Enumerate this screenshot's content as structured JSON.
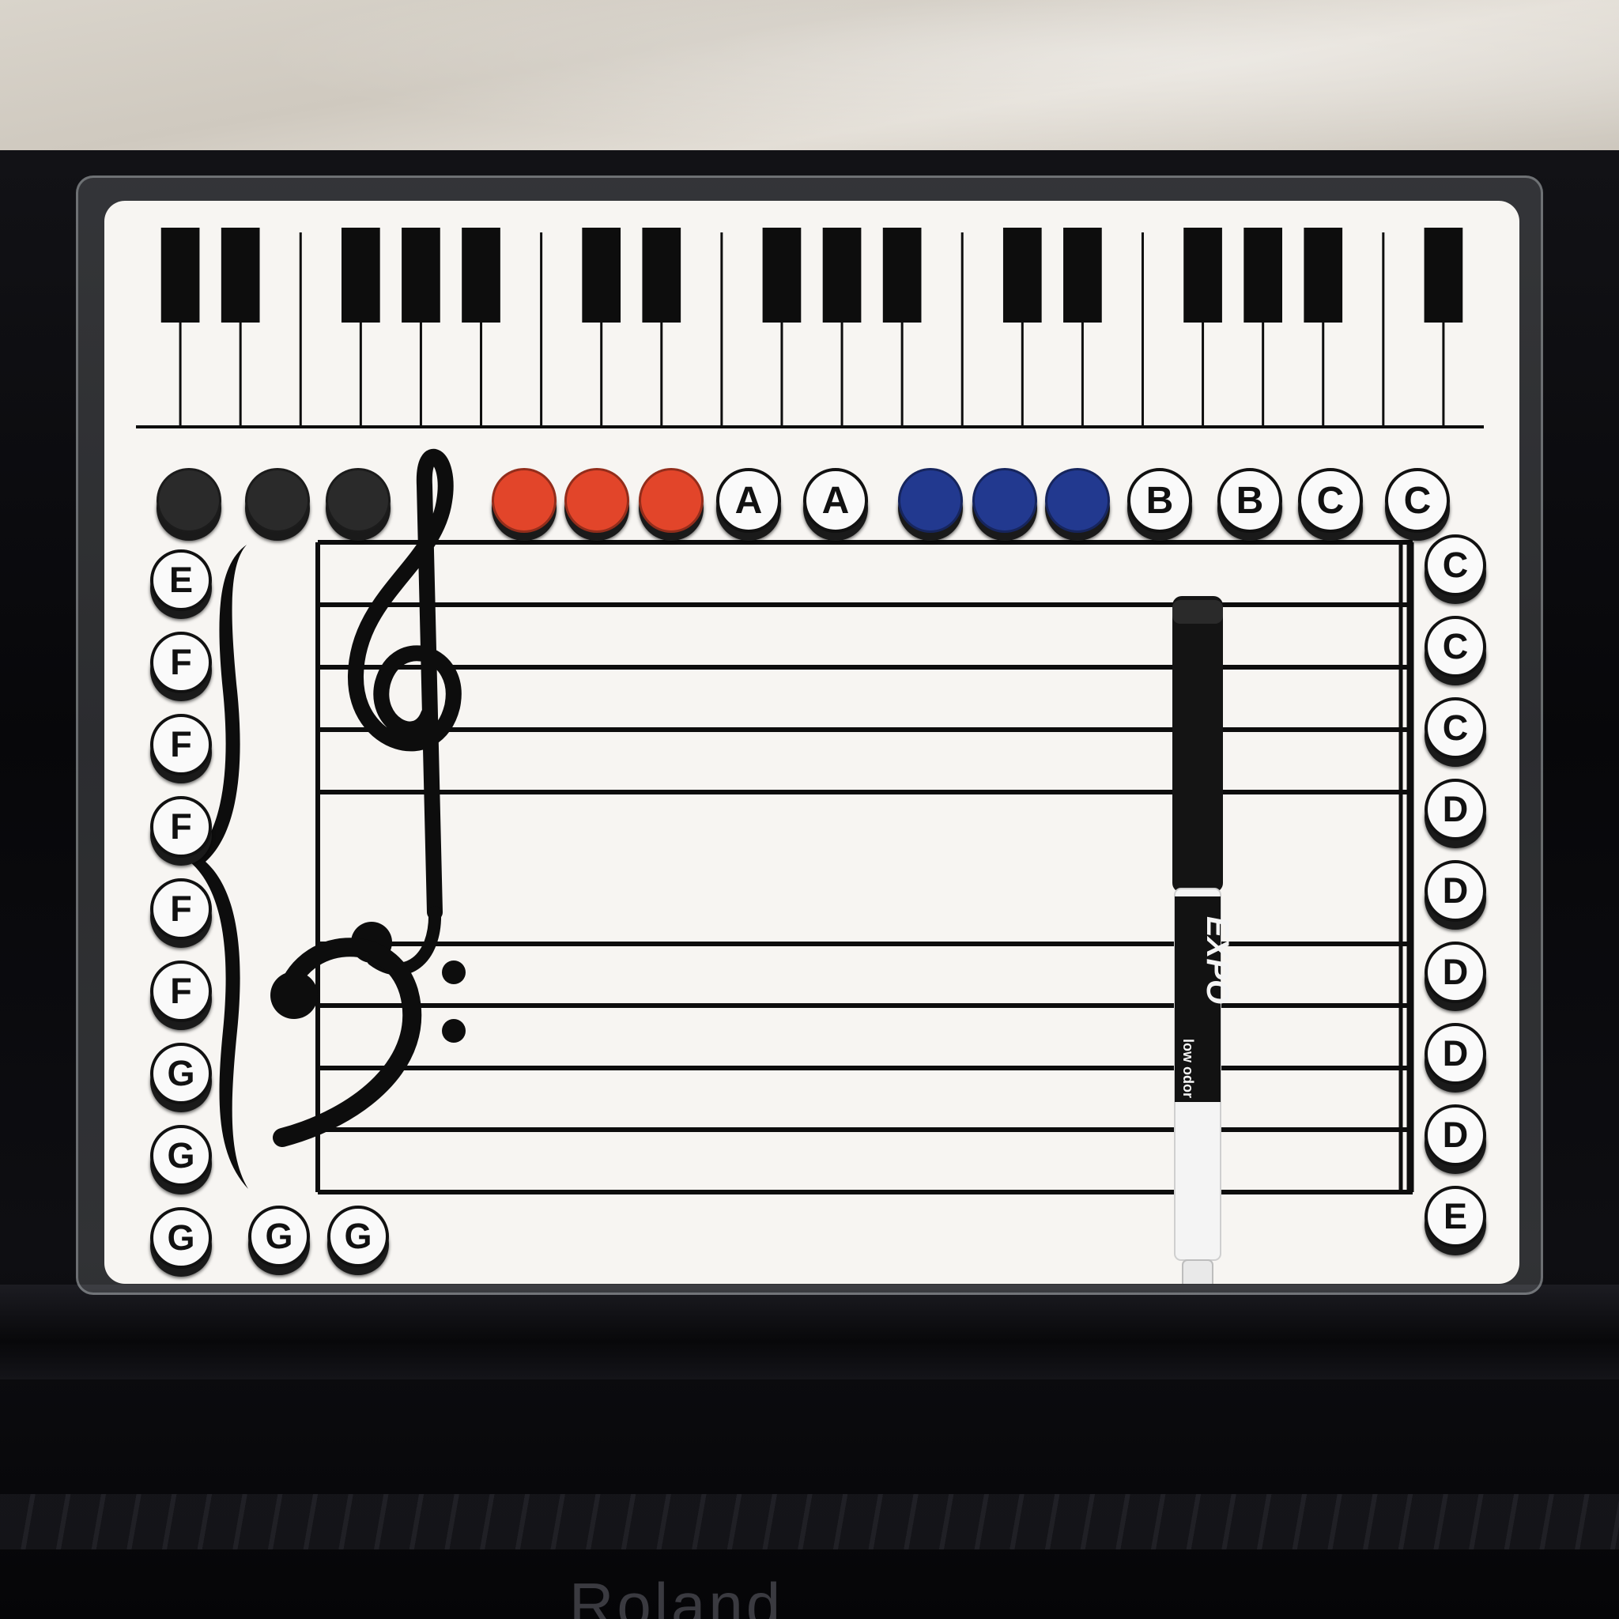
{
  "scene": {
    "brand": "Roland",
    "marker_brand": "EXPO",
    "marker_text": "low odor"
  },
  "colors": {
    "board": "#f7f5f2",
    "ink": "#0d0d0d",
    "magnet_black": "#2a2a2a",
    "magnet_red": "#e2452a",
    "magnet_blue": "#22398f"
  },
  "keyboard": {
    "white_key_count": 23,
    "black_key_pattern": [
      "b",
      "b",
      "",
      "b",
      "b",
      "b",
      "",
      "b",
      "b",
      "",
      "b",
      "b",
      "b",
      "",
      "b",
      "b",
      "",
      "b",
      "b",
      "b",
      "",
      "b"
    ]
  },
  "magnets_top": [
    {
      "kind": "black"
    },
    {
      "kind": "black"
    },
    {
      "kind": "black"
    },
    {
      "kind": "red"
    },
    {
      "kind": "red"
    },
    {
      "kind": "red"
    },
    {
      "kind": "letter",
      "label": "A"
    },
    {
      "kind": "letter",
      "label": "A"
    },
    {
      "kind": "blue"
    },
    {
      "kind": "blue"
    },
    {
      "kind": "blue"
    },
    {
      "kind": "letter",
      "label": "B"
    },
    {
      "kind": "letter",
      "label": "B"
    },
    {
      "kind": "letter",
      "label": "C"
    },
    {
      "kind": "letter",
      "label": "C"
    }
  ],
  "magnets_left": [
    "E",
    "F",
    "F",
    "F",
    "F",
    "F",
    "G",
    "G",
    "G"
  ],
  "magnets_bottom": [
    "G",
    "G"
  ],
  "magnets_right": [
    "C",
    "C",
    "C",
    "D",
    "D",
    "D",
    "D",
    "D",
    "E"
  ]
}
